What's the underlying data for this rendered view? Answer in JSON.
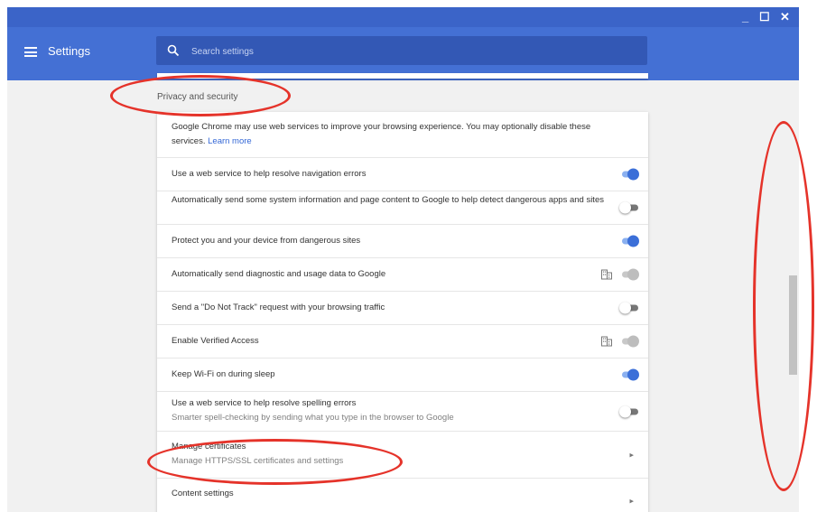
{
  "window": {
    "controls": {
      "minimize": "_",
      "maximize": "☐",
      "close": "✕"
    }
  },
  "appbar": {
    "title": "Settings",
    "search_placeholder": "Search settings"
  },
  "section": {
    "title": "Privacy and security",
    "intro_text": "Google Chrome may use web services to improve your browsing experience. You may optionally disable these services.",
    "intro_link": "Learn more",
    "rows": [
      {
        "label": "Use a web service to help resolve navigation errors",
        "state": "on"
      },
      {
        "label": "Automatically send some system information and page content to Google to help detect dangerous apps and sites",
        "state": "off"
      },
      {
        "label": "Protect you and your device from dangerous sites",
        "state": "on"
      },
      {
        "label": "Automatically send diagnostic and usage data to Google",
        "state": "managed"
      },
      {
        "label": "Send a \"Do Not Track\" request with your browsing traffic",
        "state": "off"
      },
      {
        "label": "Enable Verified Access",
        "state": "managed"
      },
      {
        "label": "Keep Wi-Fi on during sleep",
        "state": "on"
      },
      {
        "label": "Use a web service to help resolve spelling errors",
        "sublabel": "Smarter spell-checking by sending what you type in the browser to Google",
        "state": "off"
      }
    ],
    "links": [
      {
        "label": "Manage certificates",
        "sublabel": "Manage HTTPS/SSL certificates and settings"
      },
      {
        "label": "Content settings"
      }
    ]
  },
  "colors": {
    "titlebar": "#3b64c8",
    "appbar": "#4470d4",
    "toggle_on": "#3b6fd8",
    "annotation": "#e5332a"
  },
  "icons": {
    "menu": "menu-icon",
    "search": "search-icon",
    "enterprise": "enterprise-icon",
    "chevron": "chevron-right-icon"
  }
}
